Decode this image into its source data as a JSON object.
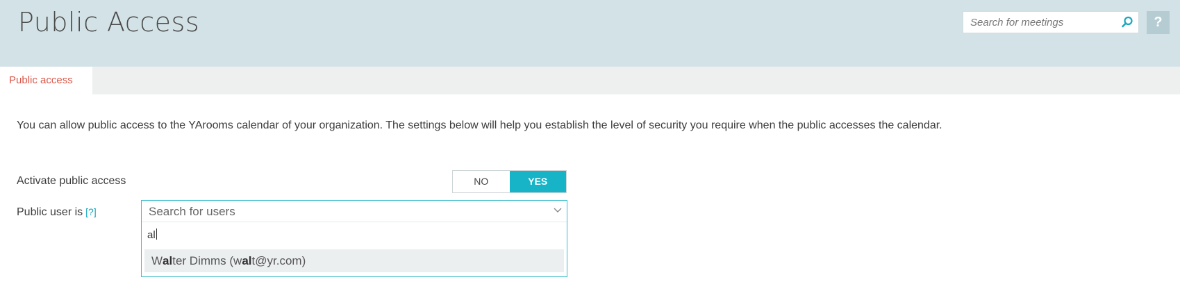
{
  "header": {
    "title": "Public Access",
    "search_placeholder": "Search for meetings",
    "help_label": "?"
  },
  "tabs": [
    {
      "label": "Public access",
      "active": true
    }
  ],
  "intro_text": "You can allow public access to the YArooms calendar of your organization. The settings below will help you establish the level of security you require when the public accesses the calendar.",
  "activate": {
    "label": "Activate public access",
    "options": [
      "NO",
      "YES"
    ],
    "selected": "YES"
  },
  "public_user": {
    "label": "Public user is",
    "help_link": "[?]",
    "placeholder": "Search for users",
    "query": "al",
    "results": [
      {
        "pre1": "W",
        "match1": "al",
        "post1": "ter Dimms (w",
        "match2": "al",
        "post2": "t@yr.com)"
      }
    ]
  },
  "colors": {
    "header_bg": "#d3e2e6",
    "accent": "#17b3c7",
    "tab_text": "#d9584a"
  }
}
